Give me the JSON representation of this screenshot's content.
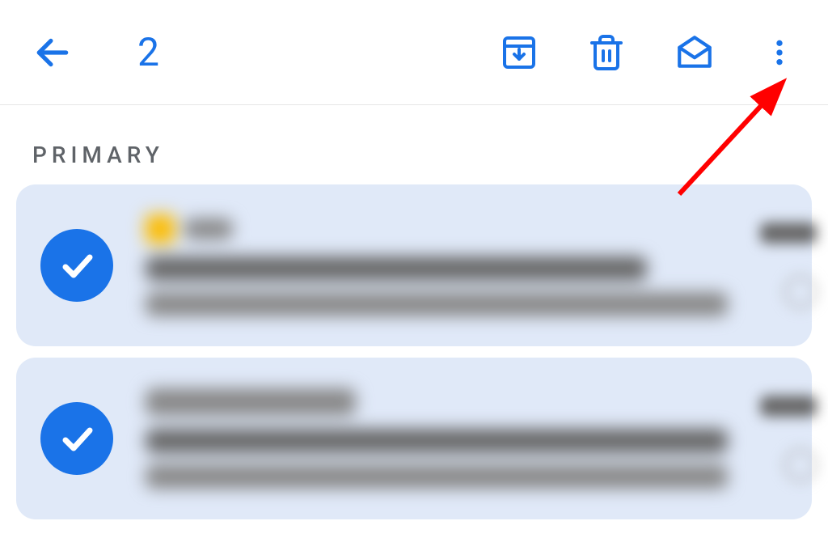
{
  "toolbar": {
    "selected_count": "2"
  },
  "section": {
    "label": "PRIMARY"
  },
  "colors": {
    "accent": "#1a73e8",
    "item_bg": "#e0e9f8",
    "text_muted": "#5f6368",
    "annotation": "#ff0000"
  },
  "emails": [
    {
      "selected": true
    },
    {
      "selected": true
    }
  ]
}
